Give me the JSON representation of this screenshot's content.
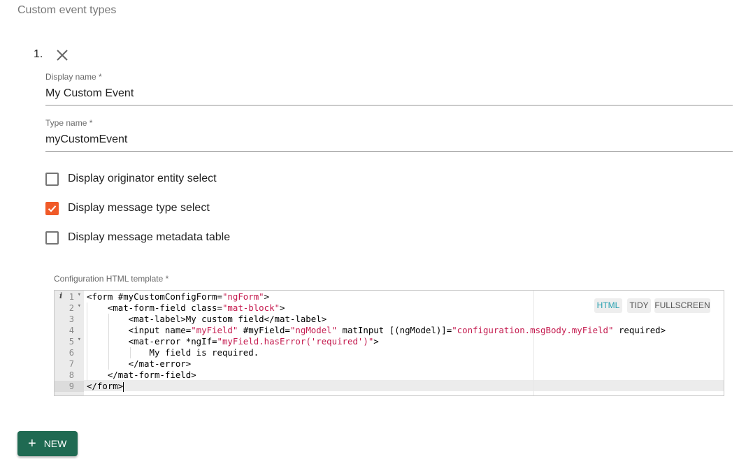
{
  "section": {
    "title": "Custom event types"
  },
  "item": {
    "index": "1.",
    "display_name": {
      "label": "Display name *",
      "value": "My Custom Event"
    },
    "type_name": {
      "label": "Type name *",
      "value": "myCustomEvent"
    },
    "checkboxes": [
      {
        "label": "Display originator entity select",
        "checked": false
      },
      {
        "label": "Display message type select",
        "checked": true
      },
      {
        "label": "Display message metadata table",
        "checked": false
      }
    ],
    "template": {
      "label": "Configuration HTML template *",
      "toolbar": {
        "html": "HTML",
        "tidy": "TIDY",
        "fullscreen": "FULLSCREEN"
      },
      "line_numbers": [
        "1",
        "2",
        "3",
        "4",
        "5",
        "6",
        "7",
        "8",
        "9"
      ],
      "code": [
        "<form #myCustomConfigForm=\"ngForm\">",
        "    <mat-form-field class=\"mat-block\">",
        "        <mat-label>My custom field</mat-label>",
        "        <input name=\"myField\" #myField=\"ngModel\" matInput [(ngModel)]=\"configuration.msgBody.myField\" required>",
        "        <mat-error *ngIf=\"myField.hasError('required')\">",
        "            My field is required.",
        "        </mat-error>",
        "    </mat-form-field>",
        "</form>"
      ]
    }
  },
  "actions": {
    "new_label": "NEW"
  },
  "colors": {
    "accent": "#f05a28",
    "primary": "#1f6a52",
    "string": "#c41a4e"
  }
}
